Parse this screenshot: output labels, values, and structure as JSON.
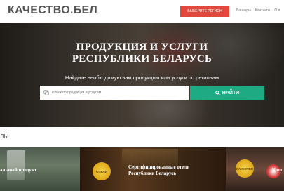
{
  "header": {
    "logo": "КАЧЕСТВО.БЕЛ",
    "region_button": "ВЫБЕРИТЕ РЕГИОН",
    "nav": [
      "Баннеры",
      "Контакты",
      "О п"
    ]
  },
  "hero": {
    "title_line1": "ПРОДУКЦИЯ И УСЛУГИ",
    "title_line2": "РЕСПУБЛИКИ БЕЛАРУСЬ",
    "subtitle": "Найдите необходимую вам продукцию или услуги по регионам",
    "search": {
      "placeholder": "Поиск по продукции и услугам",
      "button": "НАЙТИ"
    }
  },
  "section": {
    "title": "ЛЫ"
  },
  "cards": [
    {
      "title": "альный продукт"
    },
    {
      "badge": "ОТЕЛИ",
      "title_line1": "Сертифицированные отели",
      "title_line2": "Республики Беларусь"
    },
    {
      "badge": "КАЧЕСТВО",
      "title": "Кош"
    }
  ],
  "colors": {
    "accent_red": "#e2483d",
    "accent_green": "#1eaa82"
  }
}
